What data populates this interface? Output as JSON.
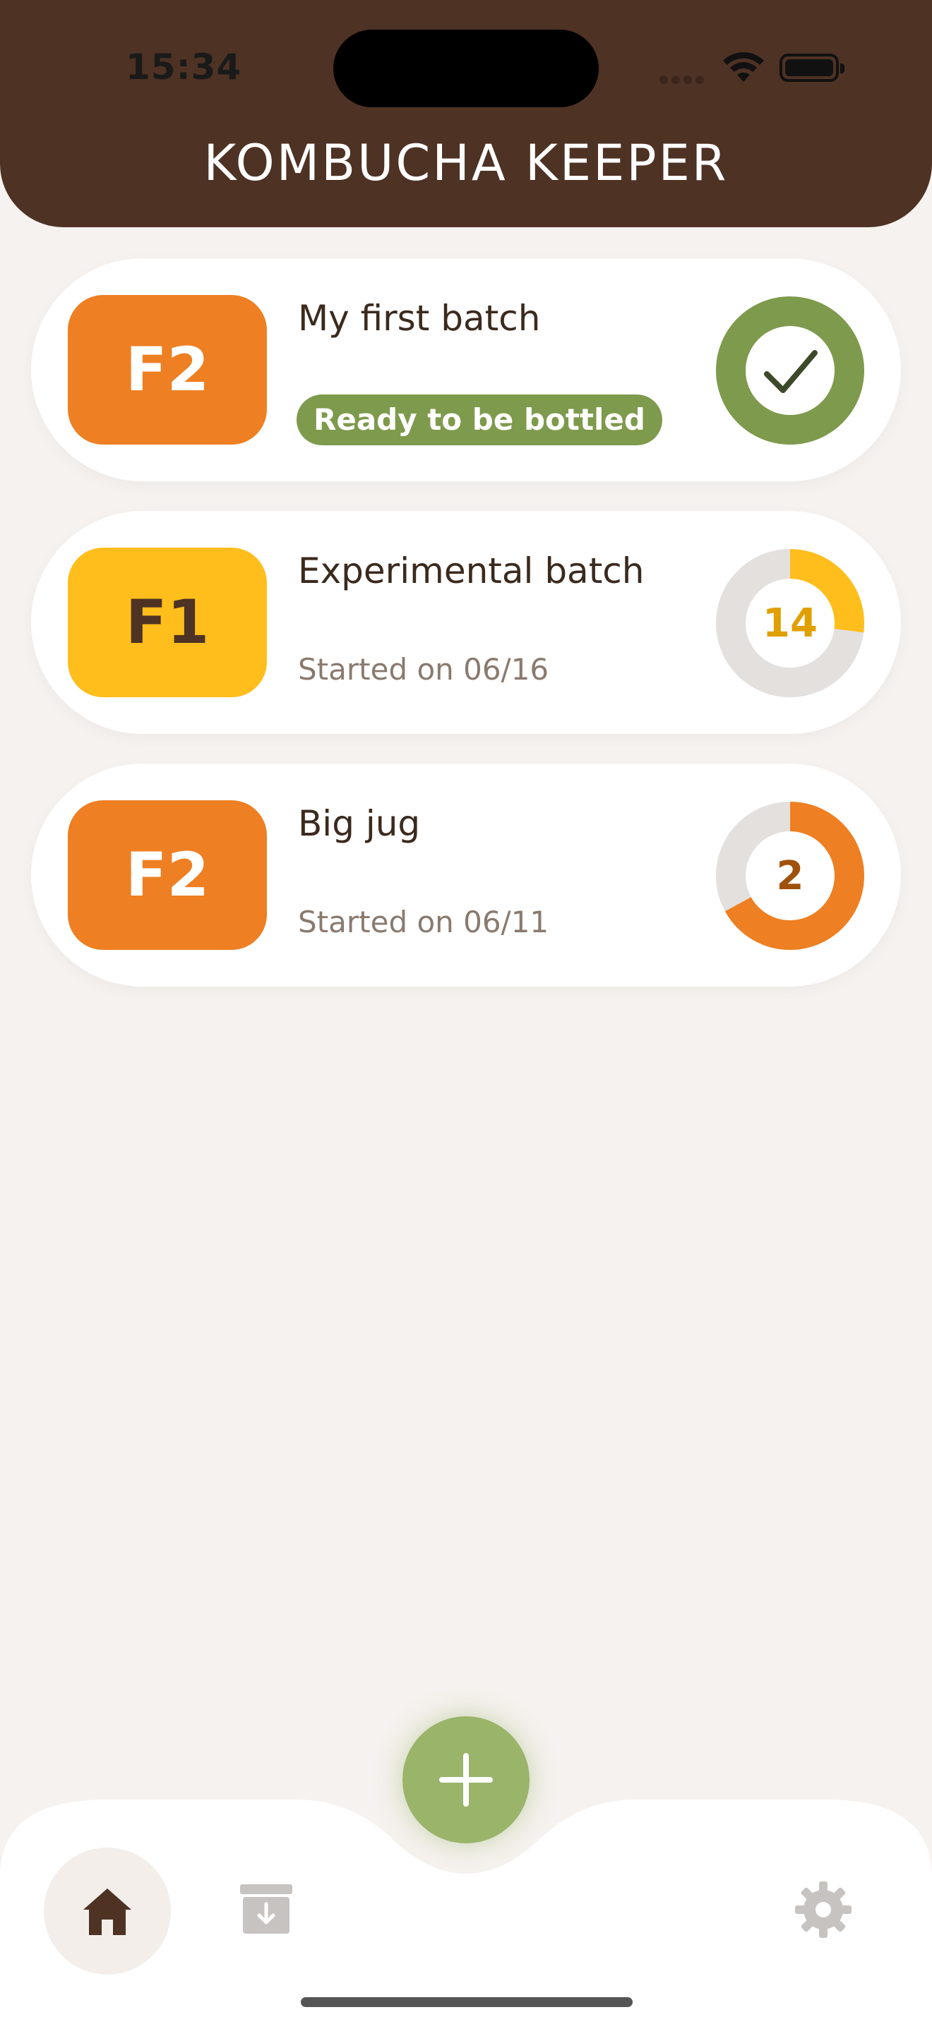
{
  "status_bar": {
    "time": "15:34"
  },
  "header": {
    "title": "KOMBUCHA KEEPER"
  },
  "batches": [
    {
      "stage": "F2",
      "name": "My first batch",
      "status": "Ready to be bottled",
      "ring_value": "",
      "ring_progress": 1.0,
      "badge_color": "#EE7F22",
      "badge_text_color": "#ffffff",
      "ring_color": "#7E9A4C"
    },
    {
      "stage": "F1",
      "name": "Experimental batch",
      "subtitle": "Started on 06/16",
      "ring_value": "14",
      "ring_progress": 0.27,
      "badge_color": "#FFBE1C",
      "badge_text_color": "#4E3224",
      "ring_color": "#FFBE1C"
    },
    {
      "stage": "F2",
      "name": "Big jug",
      "subtitle": "Started on 06/11",
      "ring_value": "2",
      "ring_progress": 0.67,
      "badge_color": "#EE7F22",
      "badge_text_color": "#ffffff",
      "ring_color": "#EE7F22"
    }
  ],
  "nav": {
    "home_icon": "home-icon",
    "archive_icon": "archive-icon",
    "settings_icon": "gear-icon",
    "add_icon": "plus-icon"
  },
  "colors": {
    "header_bg": "#4E3224",
    "page_bg": "#F6F2EF",
    "accent_green": "#9AB46A"
  }
}
